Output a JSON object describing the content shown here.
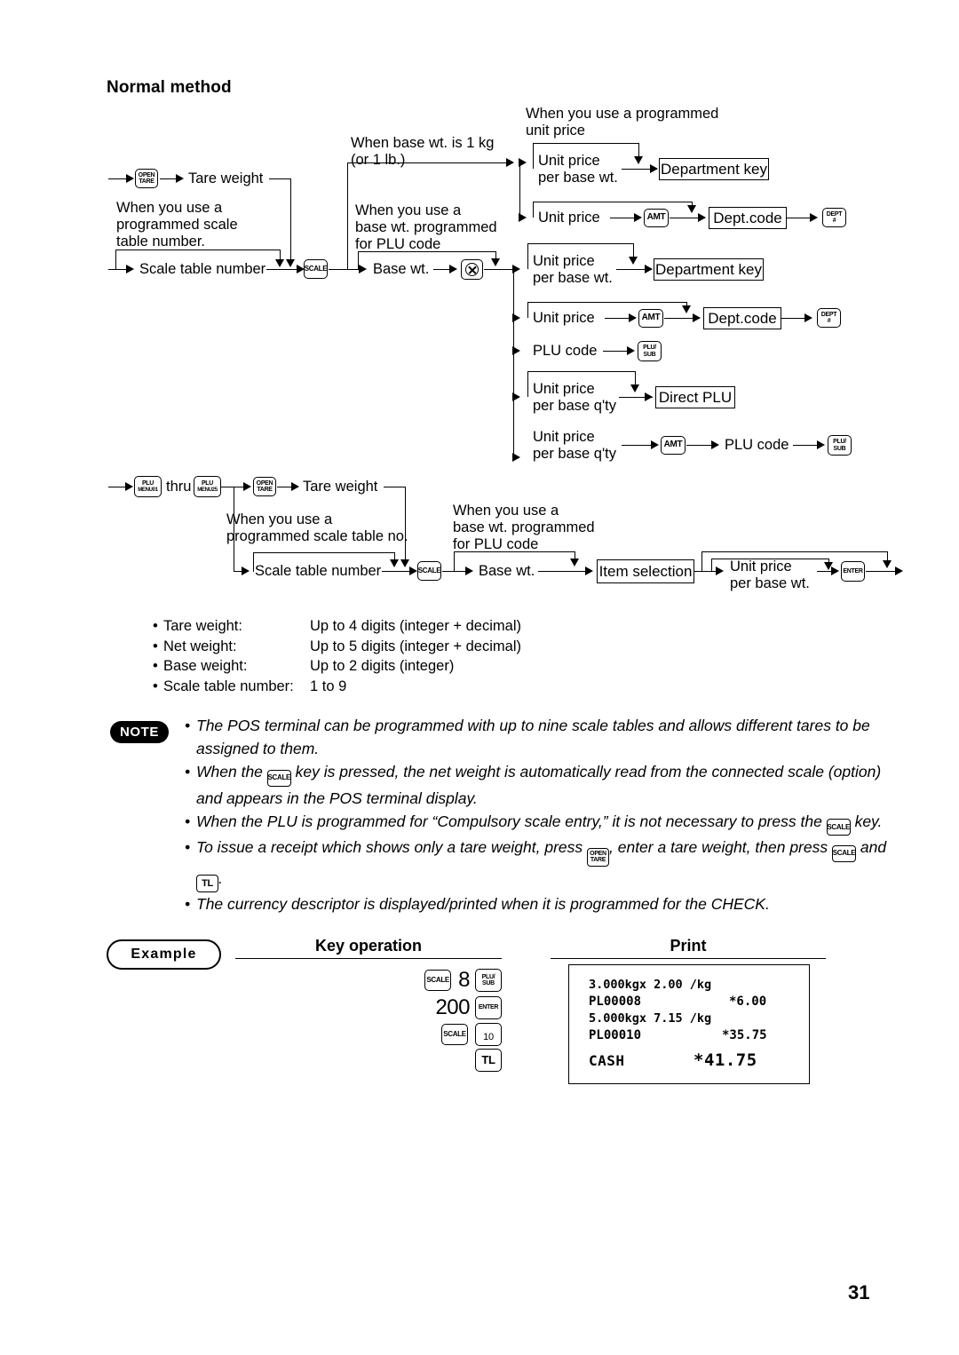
{
  "page": {
    "section_title": "Normal method",
    "page_number": "31"
  },
  "flow1": {
    "labels": {
      "tare_weight": "Tare weight",
      "note_scale_table": "When you use a\nprogrammed scale\ntable number.",
      "scale_table_number": "Scale table number",
      "note_base_wt_1kg": "When base wt. is 1 kg\n(or 1 lb.)",
      "note_base_wt_plu": "When you use a\nbase wt. programmed\nfor PLU code",
      "base_wt": "Base wt.",
      "note_programmed_unit_price": "When you use a programmed\nunit price",
      "unit_price_per_base_wt": "Unit price\nper base wt.",
      "unit_price": "Unit price",
      "plu_code": "PLU code",
      "unit_price_per_base_qty": "Unit price\nper base q'ty",
      "department_key": "Department key",
      "dept_code": "Dept.code",
      "direct_plu": "Direct PLU"
    },
    "keys": {
      "open_tare_1": "OPEN",
      "open_tare_2": "TARE",
      "scale": "SCALE",
      "multiply": "circle-x",
      "amt": "AMT",
      "dept_1": "DEPT",
      "dept_2": "#",
      "plu_1": "PLU/",
      "plu_2": "SUB"
    }
  },
  "flow2": {
    "labels": {
      "thru": "thru",
      "tare_weight": "Tare weight",
      "note_scale_table": "When you use a\nprogrammed scale table no.",
      "scale_table_number": "Scale table number",
      "note_base_wt_plu": "When you use a\nbase wt. programmed\nfor PLU code",
      "base_wt": "Base wt.",
      "item_selection": "Item selection",
      "unit_price_per_base_wt": "Unit price\nper base wt."
    },
    "keys": {
      "plu_menu01_1": "PLU",
      "plu_menu01_2": "MENU01",
      "plu_menu25_1": "PLU",
      "plu_menu25_2": "MENU25",
      "open_tare_1": "OPEN",
      "open_tare_2": "TARE",
      "scale": "SCALE",
      "enter": "ENTER"
    }
  },
  "specs": [
    {
      "bullet": "•",
      "label": "Tare weight:",
      "value": "Up to 4 digits (integer + decimal)"
    },
    {
      "bullet": "•",
      "label": "Net weight:",
      "value": "Up to 5 digits (integer + decimal)"
    },
    {
      "bullet": "•",
      "label": "Base weight:",
      "value": "Up to 2 digits (integer)"
    },
    {
      "bullet": "•",
      "label": "Scale table number:",
      "value": "1 to 9"
    }
  ],
  "note": {
    "badge": "NOTE",
    "bullet": "•",
    "items": {
      "n1": "The POS terminal can be programmed with up to nine scale tables and allows different tares to be assigned to them.",
      "n2_a": "When the",
      "n2_b": "key is pressed, the net weight is automatically read from the connected scale (option) and appears in the POS terminal display.",
      "n3_a": "When the PLU is programmed for “Compulsory scale entry,” it is not necessary to press the",
      "n3_b": "key.",
      "n4_a": "To issue a receipt which shows only a tare weight, press",
      "n4_b": ", enter a tare weight, then press",
      "n4_c": "and",
      "n4_d": ".",
      "n5": "The currency descriptor is displayed/printed when it is programmed for the CHECK."
    },
    "keys": {
      "scale": "SCALE",
      "open_1": "OPEN",
      "open_2": "TARE",
      "tl": "TL"
    }
  },
  "example": {
    "pill": "Example",
    "key_operation_title": "Key operation",
    "print_title": "Print",
    "keys": {
      "scale": "SCALE",
      "plu_1": "PLU/",
      "plu_2": "SUB",
      "enter": "ENTER",
      "ten": "10",
      "tl": "TL"
    },
    "entries": {
      "eight": "8",
      "two_hundred": "200"
    },
    "receipt": {
      "line1": "3.000kgx 2.00 /kg",
      "line2_left": "PL00008",
      "line2_right": "*6.00",
      "line3": "5.000kgx 7.15 /kg",
      "line4_left": "PL00010",
      "line4_right": "*35.75",
      "line5_left": "CASH",
      "line5_right": "*41.75"
    }
  }
}
